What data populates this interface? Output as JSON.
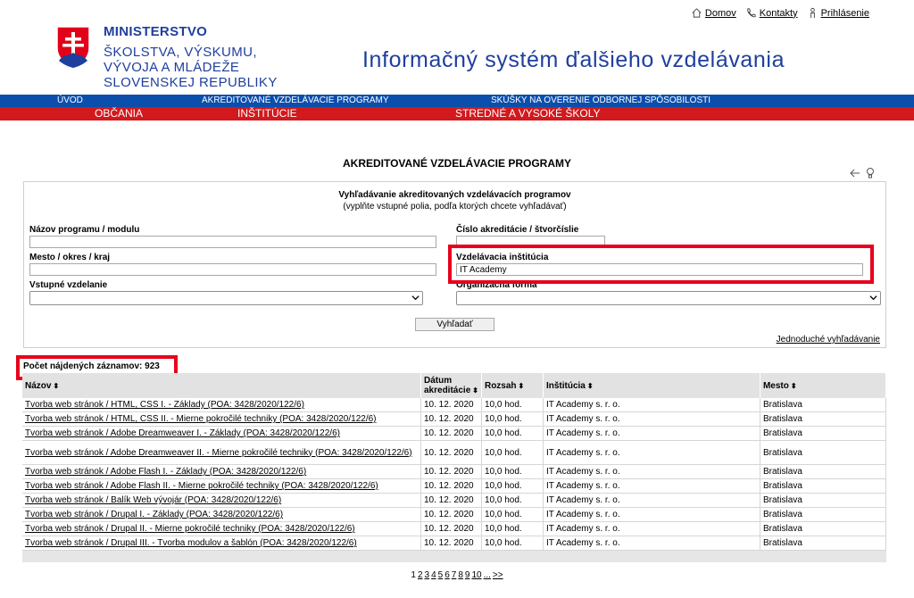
{
  "header": {
    "links": [
      {
        "label": "Domov",
        "icon": "home-icon"
      },
      {
        "label": "Kontakty",
        "icon": "phone-icon"
      },
      {
        "label": "Prihlásenie",
        "icon": "person-icon"
      }
    ],
    "ministry_line1": "MINISTERSTVO",
    "ministry_line2": "ŠKOLSTVA, VÝSKUMU,",
    "ministry_line3": "VÝVOJA A MLÁDEŽE",
    "ministry_line4": "SLOVENSKEJ REPUBLIKY",
    "system_title": "Informačný systém ďalšieho vzdelávania"
  },
  "nav": {
    "blue": [
      "ÚVOD",
      "AKREDITOVANÉ VZDELÁVACIE PROGRAMY",
      "SKÚŠKY NA OVERENIE ODBORNEJ SPÔSOBILOSTI"
    ],
    "red": [
      "OBČANIA",
      "INŠTITÚCIE",
      "STREDNÉ A VYSOKÉ ŠKOLY"
    ]
  },
  "page_title": "AKREDITOVANÉ VZDELÁVACIE PROGRAMY",
  "search": {
    "title": "Vyhľadávanie akreditovaných vzdelávacích programov",
    "hint": "(vyplňte vstupné polia, podľa ktorých chcete vyhľadávať)",
    "name_label": "Názov programu / modulu",
    "name_value": "",
    "accr_label": "Číslo akreditácie / štvorčíslie",
    "accr_value": "",
    "city_label": "Mesto / okres / kraj",
    "city_value": "",
    "inst_label": "Vzdelávacia inštitúcia",
    "inst_value": "IT Academy",
    "edu_label": "Vstupné vzdelanie",
    "edu_value": "",
    "form_label": "Organizačná forma",
    "form_value": "",
    "button": "Vyhľadať",
    "simple_link": "Jednoduché vyhľadávanie"
  },
  "count_text": "Počet nájdených záznamov: 923",
  "table": {
    "headers": {
      "name": "Názov",
      "date_line1": "Dátum",
      "date_line2": "akreditácie",
      "range": "Rozsah",
      "inst": "Inštitúcia",
      "city": "Mesto"
    },
    "rows": [
      {
        "name": "Tvorba web stránok / HTML, CSS I. - Základy (POA: 3428/2020/122/6)",
        "date": "10. 12. 2020",
        "range": "10,0 hod.",
        "inst": "IT Academy s. r. o.",
        "city": "Bratislava"
      },
      {
        "name": "Tvorba web stránok / HTML, CSS II. - Mierne pokročilé techniky (POA: 3428/2020/122/6)",
        "date": "10. 12. 2020",
        "range": "10,0 hod.",
        "inst": "IT Academy s. r. o.",
        "city": "Bratislava"
      },
      {
        "name": "Tvorba web stránok / Adobe Dreamweaver I. - Základy (POA: 3428/2020/122/6)",
        "date": "10. 12. 2020",
        "range": "10,0 hod.",
        "inst": "IT Academy s. r. o.",
        "city": "Bratislava"
      },
      {
        "name": "Tvorba web stránok / Adobe Dreamweaver II. - Mierne pokročilé techniky (POA: 3428/2020/122/6)",
        "date": "10. 12. 2020",
        "range": "10,0 hod.",
        "inst": "IT Academy s. r. o.",
        "city": "Bratislava"
      },
      {
        "name": "Tvorba web stránok / Adobe Flash I. - Základy (POA: 3428/2020/122/6)",
        "date": "10. 12. 2020",
        "range": "10,0 hod.",
        "inst": "IT Academy s. r. o.",
        "city": "Bratislava"
      },
      {
        "name": "Tvorba web stránok / Adobe Flash II. - Mierne pokročilé techniky (POA: 3428/2020/122/6)",
        "date": "10. 12. 2020",
        "range": "10,0 hod.",
        "inst": "IT Academy s. r. o.",
        "city": "Bratislava"
      },
      {
        "name": "Tvorba web stránok / Balík Web vývojár (POA: 3428/2020/122/6)",
        "date": "10. 12. 2020",
        "range": "10,0 hod.",
        "inst": "IT Academy s. r. o.",
        "city": "Bratislava"
      },
      {
        "name": "Tvorba web stránok / Drupal I. - Základy (POA: 3428/2020/122/6)",
        "date": "10. 12. 2020",
        "range": "10,0 hod.",
        "inst": "IT Academy s. r. o.",
        "city": "Bratislava"
      },
      {
        "name": "Tvorba web stránok / Drupal II. - Mierne pokročilé techniky (POA: 3428/2020/122/6)",
        "date": "10. 12. 2020",
        "range": "10,0 hod.",
        "inst": "IT Academy s. r. o.",
        "city": "Bratislava"
      },
      {
        "name": "Tvorba web stránok / Drupal III. - Tvorba modulov a šablón (POA: 3428/2020/122/6)",
        "date": "10. 12. 2020",
        "range": "10,0 hod.",
        "inst": "IT Academy s. r. o.",
        "city": "Bratislava"
      }
    ]
  },
  "pager": [
    "1",
    "2",
    "3",
    "4",
    "5",
    "6",
    "7",
    "8",
    "9",
    "10",
    "...",
    ">>"
  ],
  "colors": {
    "blue_band": "#0b4eac",
    "red_band": "#d2191d",
    "brand_blue": "#1e3f9e",
    "highlight": "#e8001c"
  }
}
